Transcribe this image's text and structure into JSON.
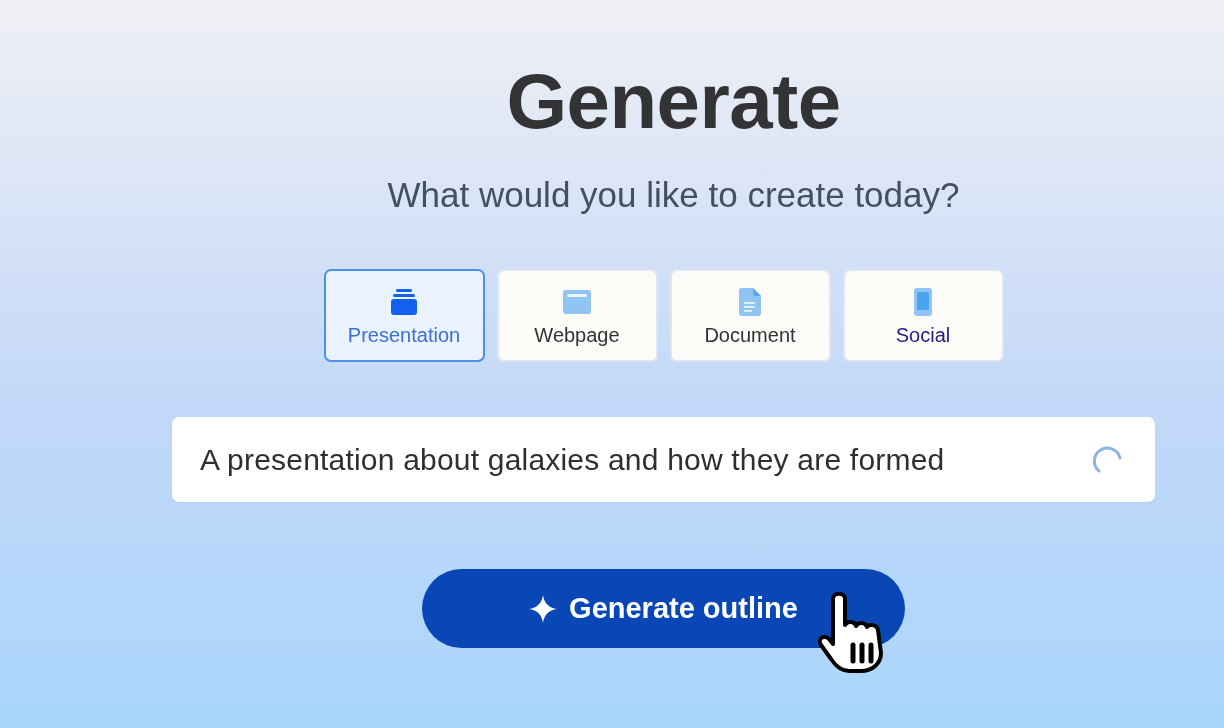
{
  "heading": {
    "title": "Generate",
    "subtitle": "What would you like to create today?"
  },
  "types": [
    {
      "kind": "presentation",
      "label": "Presentation",
      "selected": true,
      "hovered": false
    },
    {
      "kind": "webpage",
      "label": "Webpage",
      "selected": false,
      "hovered": false
    },
    {
      "kind": "document",
      "label": "Document",
      "selected": false,
      "hovered": false
    },
    {
      "kind": "social",
      "label": "Social",
      "selected": false,
      "hovered": true
    }
  ],
  "prompt": {
    "value": "A presentation about galaxies and how they are formed",
    "loading": true
  },
  "generate_button": {
    "label": "Generate outline"
  }
}
